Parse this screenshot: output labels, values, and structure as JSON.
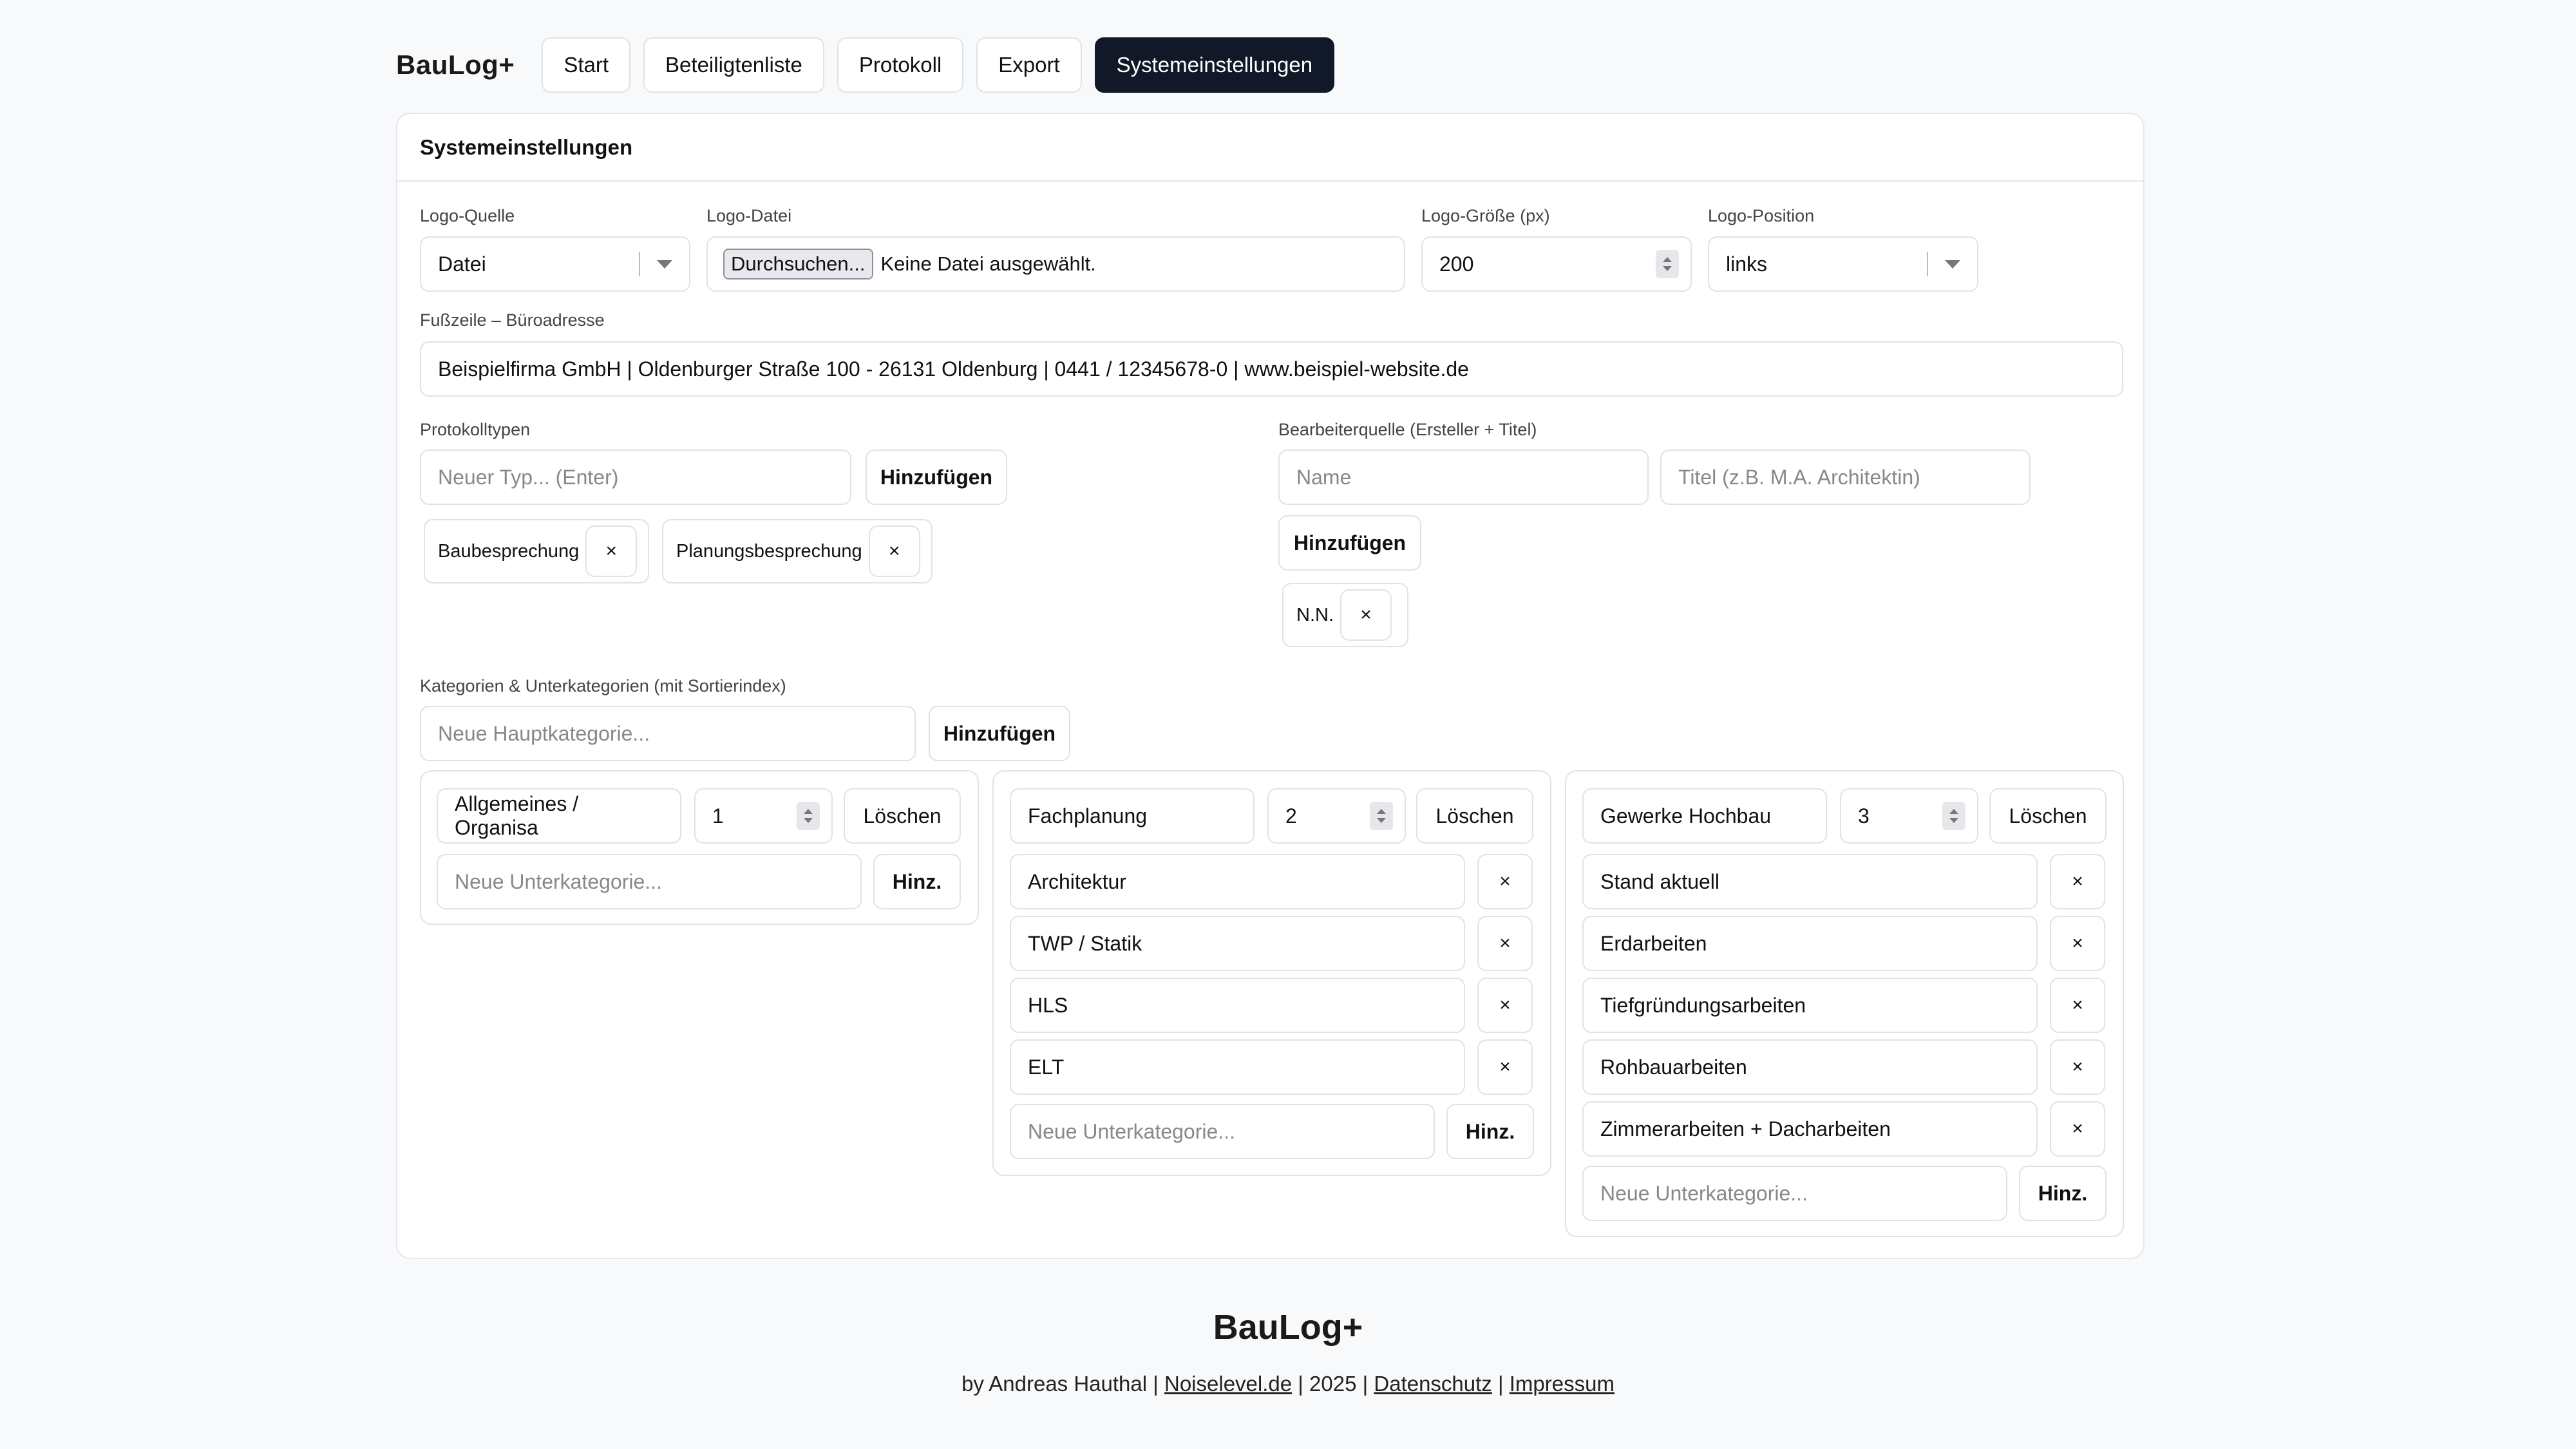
{
  "nav": {
    "brand": "BauLog+",
    "items": [
      {
        "label": "Start"
      },
      {
        "label": "Beteiligtenliste"
      },
      {
        "label": "Protokoll"
      },
      {
        "label": "Export"
      },
      {
        "label": "Systemeinstellungen"
      }
    ],
    "active": "Systemeinstellungen"
  },
  "settings": {
    "title": "Systemeinstellungen",
    "logo_source": {
      "label": "Logo-Quelle",
      "value": "Datei"
    },
    "logo_file": {
      "label": "Logo-Datei",
      "browse": "Durchsuchen...",
      "status": "Keine Datei ausgewählt."
    },
    "logo_size": {
      "label": "Logo-Größe (px)",
      "value": "200"
    },
    "logo_position": {
      "label": "Logo-Position",
      "value": "links"
    },
    "footer_address": {
      "label": "Fußzeile – Büroadresse",
      "value": "Beispielfirma GmbH | Oldenburger Straße 100 - 26131 Oldenburg | 0441 / 12345678-0 | www.beispiel-website.de"
    },
    "protocol_types": {
      "label": "Protokolltypen",
      "placeholder": "Neuer Typ... (Enter)",
      "add": "Hinzufügen",
      "items": [
        "Baubesprechung",
        "Planungsbesprechung"
      ]
    },
    "editors": {
      "label": "Bearbeiterquelle (Ersteller + Titel)",
      "name_placeholder": "Name",
      "title_placeholder": "Titel (z.B. M.A. Architektin)",
      "add": "Hinzufügen",
      "items": [
        "N.N."
      ]
    },
    "categories": {
      "label": "Kategorien & Unterkategorien (mit Sortierindex)",
      "placeholder": "Neue Hauptkategorie...",
      "add": "Hinzufügen",
      "delete": "Löschen",
      "sub_placeholder": "Neue Unterkategorie...",
      "sub_add": "Hinz.",
      "remove_icon": "×",
      "groups": [
        {
          "name": "Allgemeines / Organisa",
          "index": "1",
          "subs": []
        },
        {
          "name": "Fachplanung",
          "index": "2",
          "subs": [
            "Architektur",
            "TWP / Statik",
            "HLS",
            "ELT"
          ]
        },
        {
          "name": "Gewerke Hochbau",
          "index": "3",
          "subs": [
            "Stand aktuell",
            "Erdarbeiten",
            "Tiefgründungsarbeiten",
            "Rohbauarbeiten",
            "Zimmerarbeiten + Dacharbeiten"
          ]
        }
      ]
    }
  },
  "footer": {
    "title": "BauLog+",
    "by": "by Andreas Hauthal |",
    "link1": "Noiselevel.de",
    "year": "| 2025 |",
    "link2": "Datenschutz",
    "sep": "|",
    "link3": "Impressum"
  }
}
